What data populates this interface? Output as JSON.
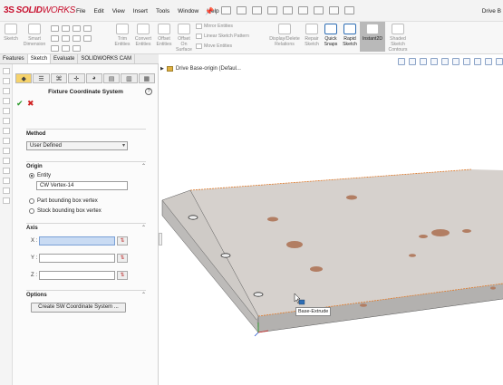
{
  "titlebar": {
    "logo_ds": "3S",
    "logo_solid": "SOLID",
    "logo_works": "WORKS",
    "menu": [
      "File",
      "Edit",
      "View",
      "Insert",
      "Tools",
      "Window",
      "Help"
    ],
    "doc_title": "Drive B"
  },
  "command_manager": {
    "sketch": "Sketch",
    "smart_dimension": "Smart\nDimension",
    "trim_entities": "Trim\nEntities",
    "convert_entities": "Convert\nEntities",
    "offset_entities": "Offset\nEntities",
    "offset_on_surface": "Offset\nOn\nSurface",
    "mirror_entities": "Mirror Entities",
    "linear_sketch_pattern": "Linear Sketch Pattern",
    "move_entities": "Move Entities",
    "display_delete_relations": "Display/Delete\nRelations",
    "repair_sketch": "Repair\nSketch",
    "quick_snaps": "Quick\nSnaps",
    "rapid_sketch": "Rapid\nSketch",
    "instant2d": "Instant2D",
    "shaded_sketch_contours": "Shaded\nSketch\nContours"
  },
  "tabs": [
    {
      "label": "Features"
    },
    {
      "label": "Sketch"
    },
    {
      "label": "Evaluate"
    },
    {
      "label": "SOLIDWORKS CAM"
    }
  ],
  "property_manager": {
    "title": "Fixture Coordinate System",
    "help": "?",
    "ok": "✔",
    "cancel": "✖",
    "method": {
      "title": "Method",
      "selected": "User Defined"
    },
    "origin": {
      "title": "Origin",
      "entity_label": "Entity",
      "entity_value": "CW Vertex-14",
      "part_bbox": "Part bounding box vertex",
      "stock_bbox": "Stock bounding box vertex"
    },
    "axis": {
      "title": "Axis",
      "x": "X :",
      "y": "Y :",
      "z": "Z :"
    },
    "options": {
      "title": "Options",
      "button": "Create SW Coordinate System ..."
    }
  },
  "graphics": {
    "tree_item": "Drive Base-origin  (Defaul...",
    "tooltip": "Base-Extrude"
  },
  "colors": {
    "plate_top": "#d6d1cd",
    "plate_side": "#b9b7b5",
    "edge_highlight": "#e07a2a",
    "selection_blue": "#c9dbf3",
    "logo_red": "#c8102e"
  }
}
